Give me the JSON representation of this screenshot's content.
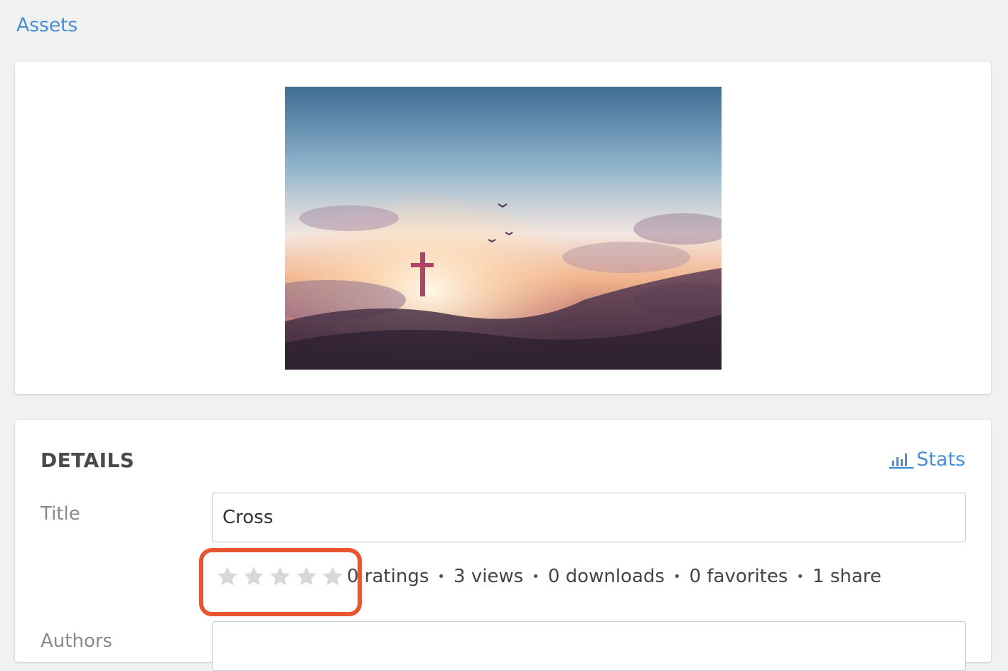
{
  "breadcrumb": {
    "label": "Assets"
  },
  "preview": {
    "icon": "photo-preview",
    "colors": {
      "sky_top": "#3f6c93",
      "glow": "#fff3d6",
      "cross": "#b0436a",
      "mountain": "#3b2a3c"
    }
  },
  "details": {
    "title": "DETAILS",
    "stats_label": "Stats",
    "stats_icon": "bar-chart-icon",
    "fields": {
      "title_label": "Title",
      "title_value": "Cross",
      "authors_label": "Authors",
      "authors_value": ""
    },
    "rating": {
      "value": 0,
      "max": 5
    },
    "counts": {
      "ratings": "0 ratings",
      "views": "3 views",
      "downloads": "0 downloads",
      "favorites": "0 favorites",
      "shares": "1 share"
    }
  },
  "colors": {
    "accent": "#4a8fd6",
    "highlight": "#e8562f",
    "star_empty": "#d8d8d8",
    "background": "#f1f1f1"
  }
}
